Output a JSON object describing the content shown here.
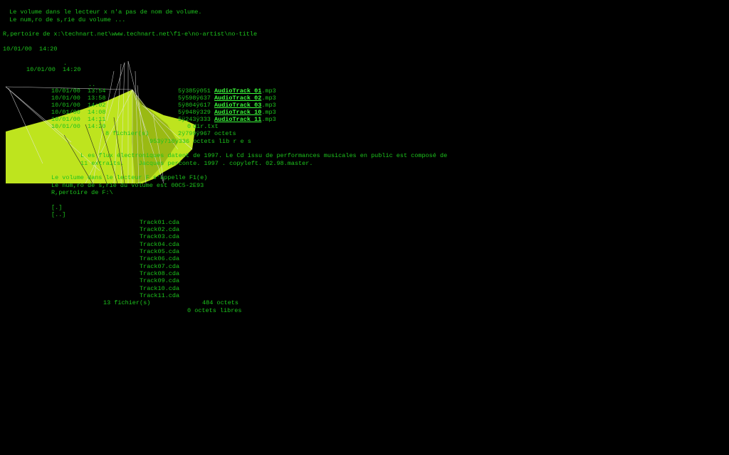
{
  "colors": {
    "text": "#1dc41d",
    "link": "#3cff3c",
    "background": "#000000",
    "shape": "#c8f020"
  },
  "header": {
    "line1": " Le volume dans le lecteur x n'a pas de nom de volume.",
    "line2": " Le num,ro de s,rie du volume ...",
    "path": "R,pertoire de x:\\technart.net\\www.technart.net\\f1-e\\no-artist\\no-title",
    "date1": "10/01/00  14:20",
    "dot": ".",
    "date2": "10/01/00  14:20",
    "dotdot": ".."
  },
  "files": [
    {
      "date": "10/01/00  13:54",
      "size": "5ÿ385ÿ051",
      "name": "AudioTrack 01",
      "ext": ".mp3"
    },
    {
      "date": "10/01/00  13:58",
      "size": "5ÿ598ÿ637",
      "name": "AudioTrack 02",
      "ext": ".mp3"
    },
    {
      "date": "10/01/00  14:02",
      "size": "5ÿ804ÿ617",
      "name": "AudioTrack 03",
      "ext": ".mp3"
    },
    {
      "date": "10/01/00  14:08",
      "size": "5ÿ948ÿ329",
      "name": "AudioTrack 10",
      "ext": ".mp3"
    },
    {
      "date": "10/01/00  14:11",
      "size": "5ÿ243ÿ333",
      "name": "AudioTrack 11",
      "ext": ".mp3"
    }
  ],
  "dirtxt": {
    "date": "10/01/00  14:20",
    "size": "0",
    "name": "dir.txt"
  },
  "summary1": {
    "files": "8 fichier(s)",
    "bytes": "2ÿ799ÿ967 octets"
  },
  "summary2": "953ÿ710ÿ336 octets lib r e s",
  "description": {
    "line1": "L es flux électroniques datent de 1997. Le Cd issu de performances musicales en public est composé de",
    "line2": "11 extraits.    Jacques perconte. 1997 . copyleft. 02.98.master."
  },
  "second": {
    "line1": "Le volume dans le lecteur F s'appelle F1(e)",
    "line2": "Le num,ro de s,rie du volume est 00C5-2E93",
    "path": "R,pertoire de F:\\",
    "dir1": "[.]",
    "dir2": "[..]"
  },
  "tracks": [
    "Track01.cda",
    "Track02.cda",
    "Track03.cda",
    "Track04.cda",
    "Track05.cda",
    "Track06.cda",
    "Track07.cda",
    "Track08.cda",
    "Track09.cda",
    "Track10.cda",
    "Track11.cda"
  ],
  "footer": {
    "files": "13 fichier(s)",
    "bytes": "484 octets",
    "free": "0 octets libres"
  }
}
